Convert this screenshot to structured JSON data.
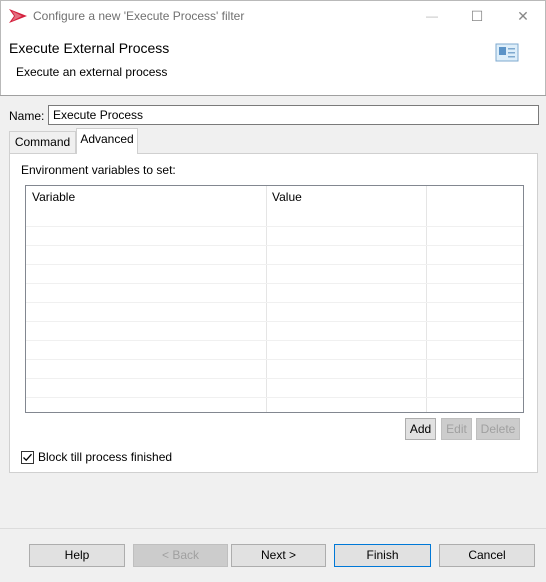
{
  "window": {
    "title": "Configure a new 'Execute Process' filter",
    "minimize_glyph": "—",
    "maximize_glyph": "☐",
    "close_glyph": "✕",
    "icon": "red-arrow-logo-icon"
  },
  "header": {
    "title": "Execute External Process",
    "subtitle": "Execute an external process",
    "image_icon": "dialog-banner-icon"
  },
  "name_field": {
    "label": "Name:",
    "value": "Execute Process"
  },
  "tabs": [
    {
      "label": "Command",
      "selected": false
    },
    {
      "label": "Advanced",
      "selected": true
    }
  ],
  "advanced": {
    "env_label": "Environment variables to set:",
    "table": {
      "columns": [
        "Variable",
        "Value"
      ],
      "rows": []
    },
    "buttons": {
      "add": "Add",
      "edit": "Edit",
      "delete": "Delete"
    },
    "block_checkbox": {
      "label": "Block till process finished",
      "checked": true
    }
  },
  "footer": {
    "help": "Help",
    "back": "< Back",
    "next": "Next >",
    "finish": "Finish",
    "cancel": "Cancel"
  },
  "colors": {
    "accent": "#0078d7",
    "logo": "#d4213d"
  }
}
